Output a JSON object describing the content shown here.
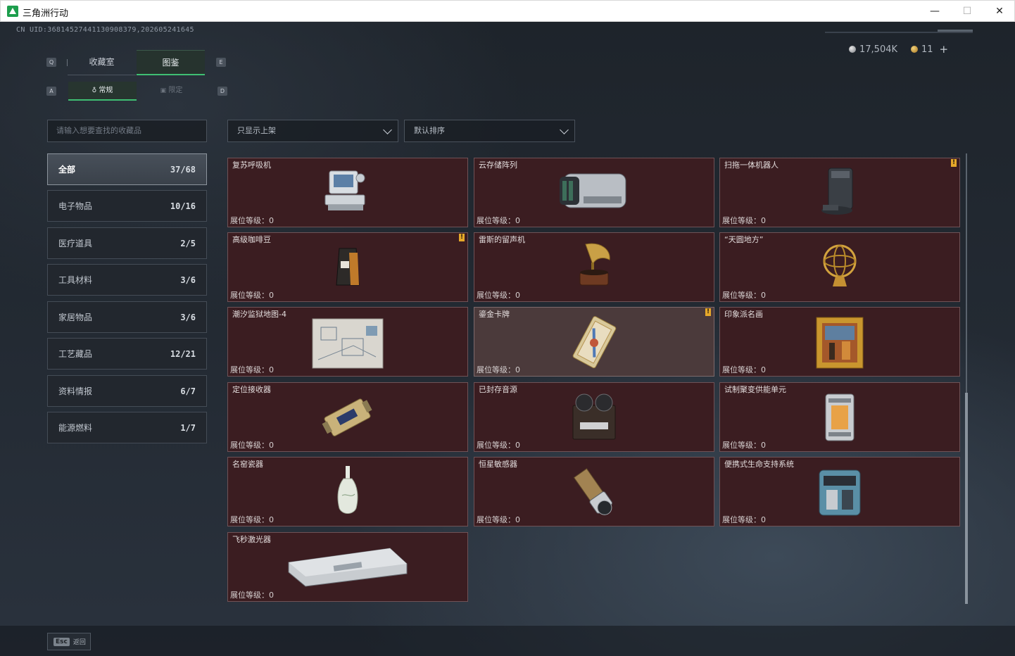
{
  "window": {
    "title": "三角洲行动",
    "min": "—",
    "max": "☐",
    "close": "✕"
  },
  "header": {
    "uid": "CN UID:36814527441130908379,202605241645",
    "silver": "17,504K",
    "gold": "11",
    "plus": "+"
  },
  "keys": {
    "q": "Q",
    "e": "E",
    "a": "A",
    "d": "D"
  },
  "tabs": {
    "collection": "收藏室",
    "catalog": "图鉴"
  },
  "subtabs": {
    "regular": "常规",
    "limited": "限定"
  },
  "search": {
    "placeholder": "请输入想要查找的收藏品"
  },
  "filters": {
    "shelf": "只显示上架",
    "sort": "默认排序"
  },
  "categories": [
    {
      "label": "全部",
      "count": "37/68"
    },
    {
      "label": "电子物品",
      "count": "10/16"
    },
    {
      "label": "医疗道具",
      "count": "2/5"
    },
    {
      "label": "工具材料",
      "count": "3/6"
    },
    {
      "label": "家居物品",
      "count": "3/6"
    },
    {
      "label": "工艺藏品",
      "count": "12/21"
    },
    {
      "label": "资料情报",
      "count": "6/7"
    },
    {
      "label": "能源燃料",
      "count": "1/7"
    }
  ],
  "items": [
    {
      "name": "复苏呼吸机",
      "level_label": "展位等级：",
      "level": "0",
      "badge": ""
    },
    {
      "name": "云存储阵列",
      "level_label": "展位等级：",
      "level": "0",
      "badge": ""
    },
    {
      "name": "扫拖一体机器人",
      "level_label": "展位等级：",
      "level": "0",
      "badge": "!"
    },
    {
      "name": "高级咖啡豆",
      "level_label": "展位等级：",
      "level": "0",
      "badge": "!"
    },
    {
      "name": "雷斯的留声机",
      "level_label": "展位等级：",
      "level": "0",
      "badge": ""
    },
    {
      "name": "“天圆地方”",
      "level_label": "展位等级：",
      "level": "0",
      "badge": ""
    },
    {
      "name": "潮汐监狱地图-4",
      "level_label": "展位等级：",
      "level": "0",
      "badge": ""
    },
    {
      "name": "鎏金卡牌",
      "level_label": "展位等级：",
      "level": "0",
      "badge": "!"
    },
    {
      "name": "印象派名画",
      "level_label": "展位等级：",
      "level": "0",
      "badge": ""
    },
    {
      "name": "定位接收器",
      "level_label": "展位等级：",
      "level": "0",
      "badge": ""
    },
    {
      "name": "已封存音源",
      "level_label": "展位等级：",
      "level": "0",
      "badge": ""
    },
    {
      "name": "试制聚变供能单元",
      "level_label": "展位等级：",
      "level": "0",
      "badge": ""
    },
    {
      "name": "名窑瓷器",
      "level_label": "展位等级：",
      "level": "0",
      "badge": ""
    },
    {
      "name": "恒星敏感器",
      "level_label": "展位等级：",
      "level": "0",
      "badge": ""
    },
    {
      "name": "便携式生命支持系统",
      "level_label": "展位等级：",
      "level": "0",
      "badge": ""
    },
    {
      "name": "飞秒激光器",
      "level_label": "展位等级：",
      "level": "0",
      "badge": ""
    }
  ],
  "footer": {
    "esc_key": "Esc",
    "esc_label": "返回"
  }
}
